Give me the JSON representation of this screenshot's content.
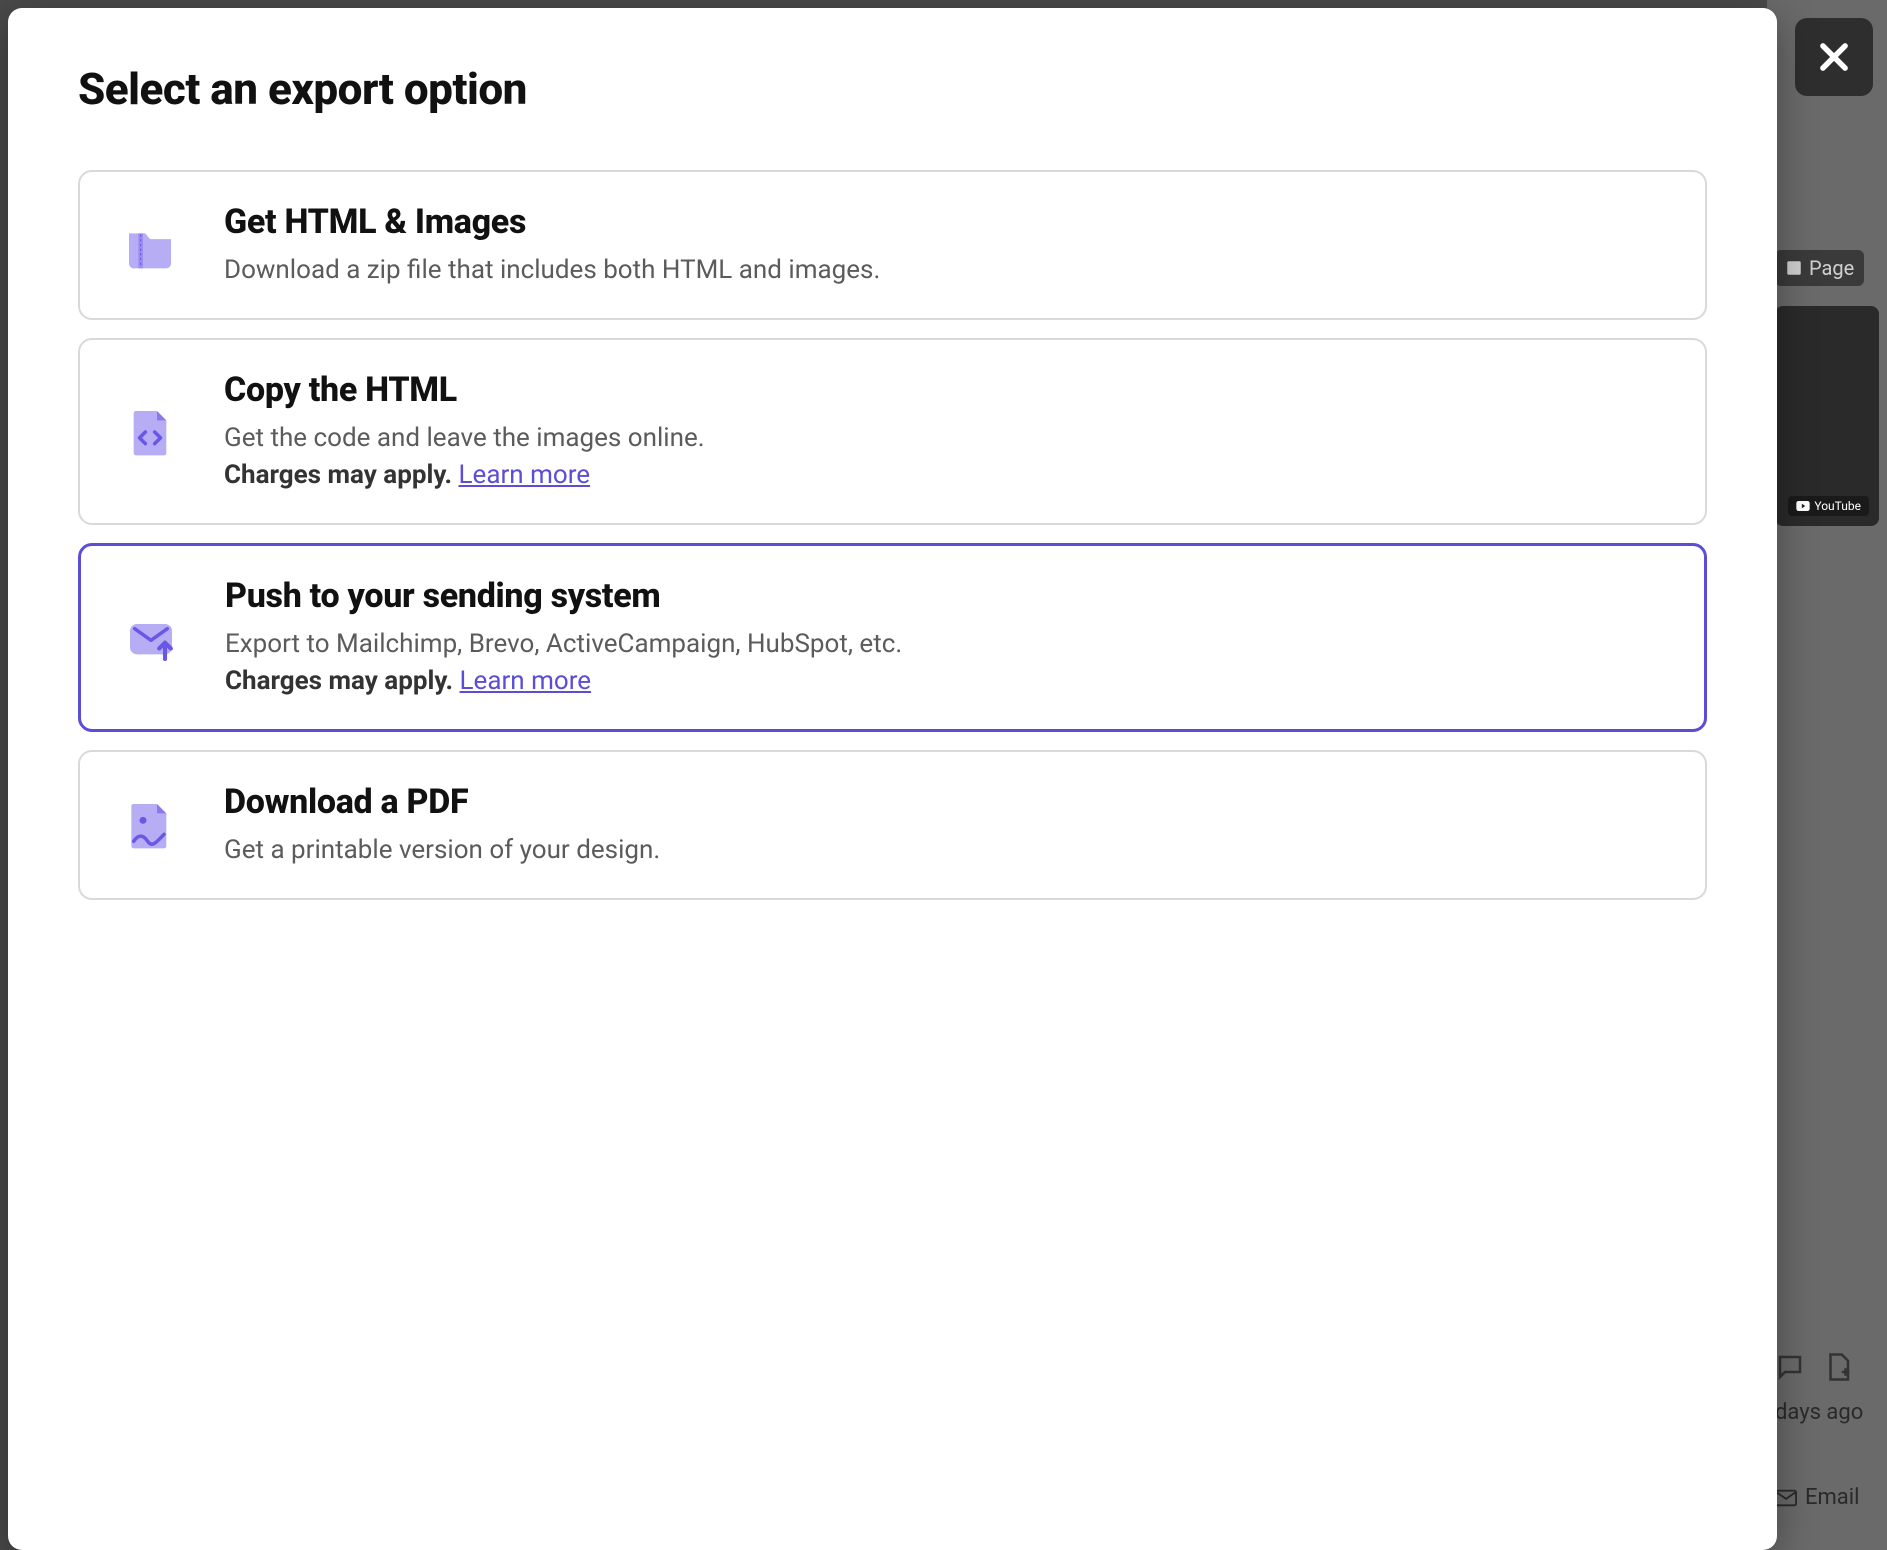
{
  "dialog": {
    "title": "Select an export option"
  },
  "options": [
    {
      "key": "html-images",
      "title": "Get HTML & Images",
      "description": "Download a zip file that includes both HTML and images.",
      "charges": "",
      "learn_more": "",
      "selected": false,
      "icon": "zip-folder-icon"
    },
    {
      "key": "copy-html",
      "title": "Copy the HTML",
      "description": "Get the code and leave the images online.",
      "charges": "Charges may apply.",
      "learn_more": "Learn more",
      "selected": false,
      "icon": "code-file-icon"
    },
    {
      "key": "push-sending",
      "title": "Push to your sending system",
      "description": "Export to Mailchimp, Brevo, ActiveCampaign, HubSpot, etc.",
      "charges": "Charges may apply.",
      "learn_more": "Learn more",
      "selected": true,
      "icon": "mail-upload-icon"
    },
    {
      "key": "download-pdf",
      "title": "Download a PDF",
      "description": "Get a printable version of your design.",
      "charges": "",
      "learn_more": "",
      "selected": false,
      "icon": "image-file-icon"
    }
  ],
  "background": {
    "page_label": "Page",
    "youtube_badge": "YouTube",
    "time_ago": "days ago",
    "email_label": "Email"
  },
  "colors": {
    "accent": "#5b4dd6",
    "icon_light": "#b7adf4",
    "icon_deep": "#6a57e8"
  }
}
